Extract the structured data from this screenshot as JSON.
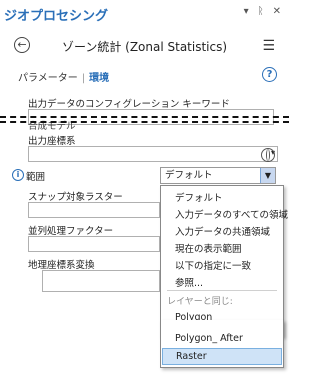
{
  "pane": {
    "title": "ジオプロセシング",
    "icons": [
      "chevron-down-icon",
      "pin-icon",
      "close-icon"
    ]
  },
  "tool": {
    "title": "ゾーン統計 (Zonal Statistics)",
    "back_icon": "arrow-left-circle-icon",
    "menu_icon": "hamburger-icon"
  },
  "tabs": {
    "parameters": "パラメーター",
    "separator": "|",
    "environments": "環境"
  },
  "help_label": "?",
  "fields": {
    "output_config_keyword": {
      "label": "出力データのコンフィグレーション キーワード",
      "value": ""
    },
    "output_coord_system": {
      "label": "出力座標系",
      "value": ""
    },
    "extent": {
      "label": "範囲",
      "value": "デフォルト"
    },
    "snap_raster": {
      "label": "スナップ対象ラスター",
      "value": ""
    },
    "parallel_factor": {
      "label": "並列処理ファクター",
      "value": ""
    },
    "geo_transform": {
      "label": "地理座標系変換",
      "value": ""
    }
  },
  "partial_label": "合成モデル",
  "extent_dropdown": {
    "items": [
      "デフォルト",
      "入力データのすべての領域",
      "入力データの共通領域",
      "現在の表示範囲",
      "以下の指定に一致",
      "参照..."
    ],
    "layer_header": "レイヤーと同じ:",
    "layers": [
      "Polygon",
      "Polygon_ After",
      "Raster"
    ],
    "selected": "Raster"
  }
}
